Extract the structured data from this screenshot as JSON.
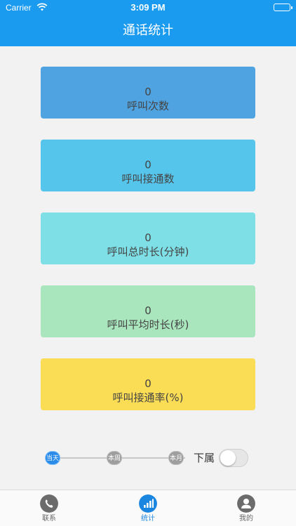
{
  "status_bar": {
    "carrier": "Carrier",
    "time": "3:09 PM"
  },
  "header": {
    "title": "通话统计"
  },
  "stats": [
    {
      "value": "0",
      "label": "呼叫次数",
      "color": "#4fa3e0"
    },
    {
      "value": "0",
      "label": "呼叫接通数",
      "color": "#56c5ec"
    },
    {
      "value": "0",
      "label": "呼叫总时长(分钟)",
      "color": "#7ee0e6"
    },
    {
      "value": "0",
      "label": "呼叫平均时长(秒)",
      "color": "#a9e5bd"
    },
    {
      "value": "0",
      "label": "呼叫接通率(%)",
      "color": "#fbdc55"
    }
  ],
  "range_selector": {
    "options": [
      "当天",
      "本周",
      "本月"
    ],
    "selected": "当天",
    "subordinate_label": "下属",
    "subordinate_enabled": false
  },
  "tabs": [
    {
      "label": "联系",
      "icon": "phone-icon",
      "active": false
    },
    {
      "label": "统计",
      "icon": "bar-chart-icon",
      "active": true
    },
    {
      "label": "我的",
      "icon": "user-icon",
      "active": false
    }
  ]
}
